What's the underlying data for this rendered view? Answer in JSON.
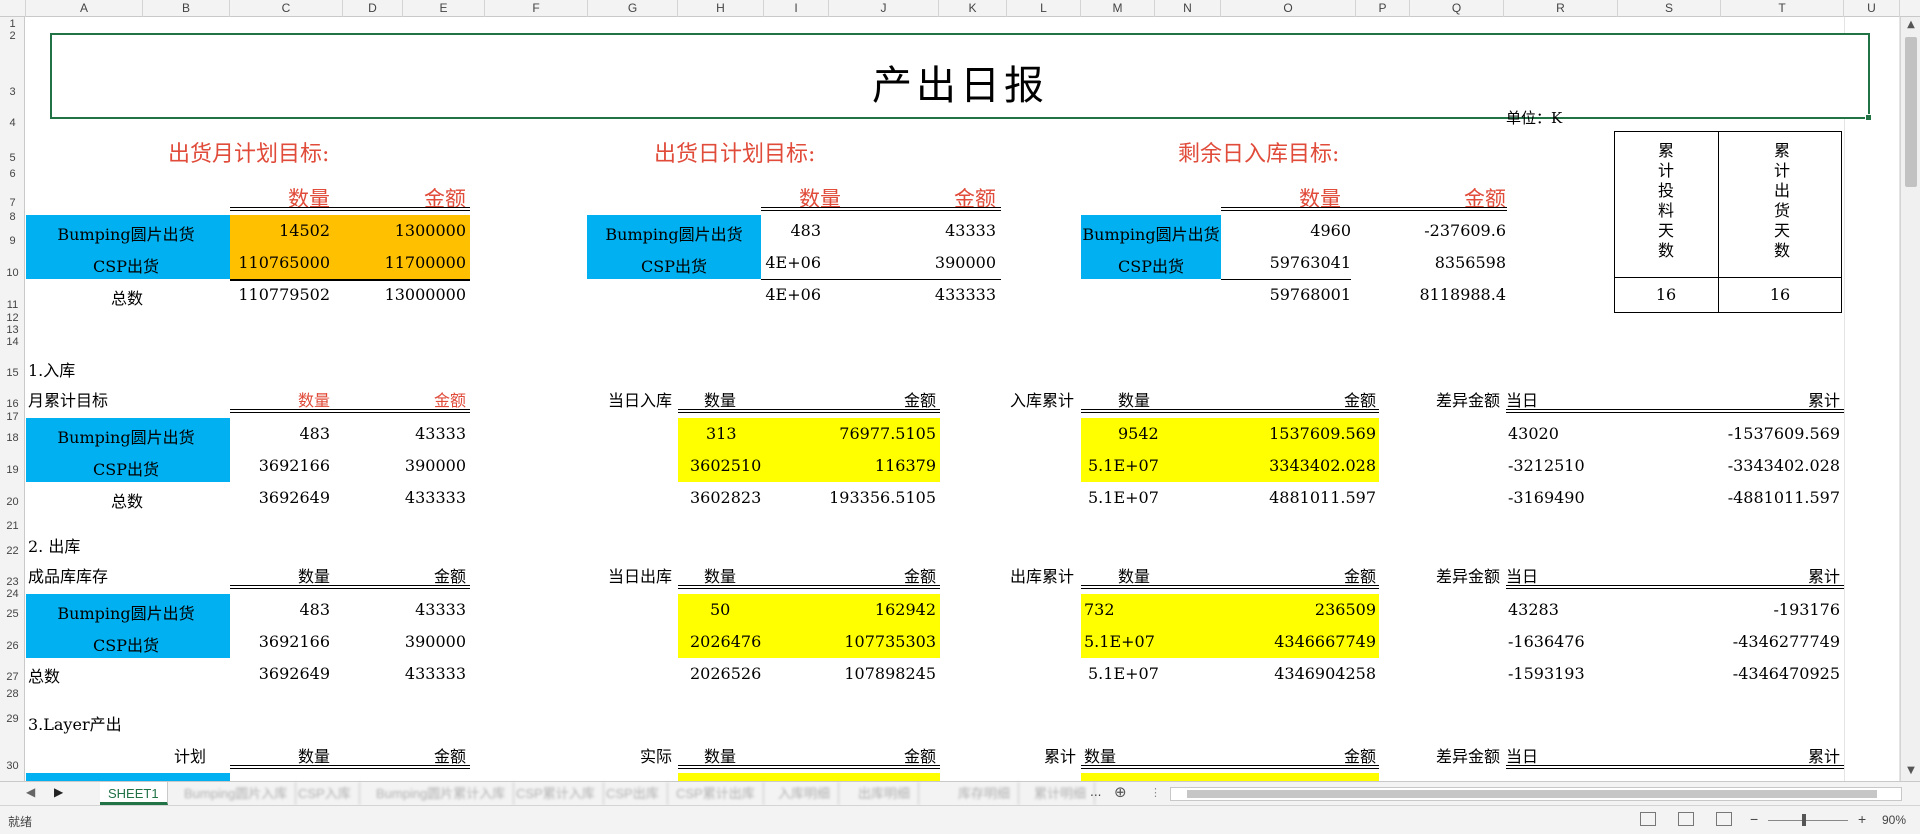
{
  "columns": [
    "A",
    "B",
    "C",
    "D",
    "E",
    "F",
    "G",
    "H",
    "I",
    "J",
    "K",
    "L",
    "M",
    "N",
    "O",
    "P",
    "Q",
    "R",
    "S",
    "T",
    "U"
  ],
  "rows": [
    "1",
    "2",
    "3",
    "4",
    "5",
    "6",
    "7",
    "8",
    "9",
    "10",
    "11",
    "12",
    "13",
    "14",
    "15",
    "16",
    "17",
    "18",
    "19",
    "20",
    "21",
    "22",
    "23",
    "24",
    "25",
    "26",
    "27",
    "28",
    "29",
    "30"
  ],
  "title": "产出日报",
  "unit": "单位：K",
  "header_labels": {
    "qty": "数量",
    "amt": "金额"
  },
  "sections_top": [
    {
      "heading": "出货月计划目标:"
    },
    {
      "heading": "出货日计划目标:"
    },
    {
      "heading": "剩余日入库目标:"
    }
  ],
  "rowlabels": {
    "bumping": "Bumping圆片出货",
    "csp": "CSP出货",
    "total": "总数"
  },
  "monthly": {
    "bumping": [
      "14502",
      "1300000"
    ],
    "csp": [
      "110765000",
      "11700000"
    ],
    "total": [
      "110779502",
      "13000000"
    ]
  },
  "daily": {
    "bumping": [
      "483",
      "43333"
    ],
    "csp": [
      "4E+06",
      "390000"
    ],
    "total": [
      "4E+06",
      "433333"
    ]
  },
  "remaining": {
    "bumping": [
      "4960",
      "-237609.6"
    ],
    "csp": [
      "59763041",
      "8356598"
    ],
    "total": [
      "59768001",
      "8118988.4"
    ]
  },
  "days": {
    "label1": "累计投料天数",
    "label2": "累计出货天数",
    "val1": "16",
    "val2": "16"
  },
  "s1": {
    "title": "1.入库",
    "left": "月累计目标",
    "mid": "当日入库",
    "right": "入库累计",
    "diff": "差异金额",
    "today": "当日",
    "cum": "累计",
    "target": {
      "bumping": [
        "483",
        "43333"
      ],
      "csp": [
        "3692166",
        "390000"
      ],
      "total": [
        "3692649",
        "433333"
      ]
    },
    "day": {
      "bumping": [
        "313",
        "76977.5105"
      ],
      "csp": [
        "3602510",
        "116379"
      ],
      "total": [
        "3602823",
        "193356.5105"
      ]
    },
    "acc": {
      "bumping": [
        "9542",
        "1537609.569"
      ],
      "csp": [
        "5.1E+07",
        "3343402.028"
      ],
      "total": [
        "5.1E+07",
        "4881011.597"
      ]
    },
    "dif": {
      "bumping": [
        "43020",
        "-1537609.569"
      ],
      "csp": [
        "-3212510",
        "-3343402.028"
      ],
      "total": [
        "-3169490",
        "-4881011.597"
      ]
    }
  },
  "s2": {
    "title": "2.  出库",
    "left": "成品库库存",
    "mid": "当日出库",
    "right": "出库累计",
    "diff": "差异金额",
    "today": "当日",
    "cum": "累计",
    "target": {
      "bumping": [
        "483",
        "43333"
      ],
      "csp": [
        "3692166",
        "390000"
      ],
      "total": [
        "3692649",
        "433333"
      ]
    },
    "day": {
      "bumping": [
        "50",
        "162942"
      ],
      "csp": [
        "2026476",
        "107735303"
      ],
      "total": [
        "2026526",
        "107898245"
      ]
    },
    "acc": {
      "bumping": [
        "732",
        "236509"
      ],
      "csp": [
        "5.1E+07",
        "4346667749"
      ],
      "total": [
        "5.1E+07",
        "4346904258"
      ]
    },
    "dif": {
      "bumping": [
        "43283",
        "-193176"
      ],
      "csp": [
        "-1636476",
        "-4346277749"
      ],
      "total": [
        "-1593193",
        "-4346470925"
      ]
    }
  },
  "s3": {
    "title": "3.Layer产出",
    "left": "计划",
    "mid": "实际",
    "right": "累计",
    "diff": "差异金额",
    "today": "当日",
    "cum": "累计"
  },
  "tabs": [
    "SHEET1",
    "Bumping圆片入库",
    "CSP入库",
    "Bumping圆片累计入库",
    "CSP累计入库",
    "CSP出库",
    "CSP累计出库",
    "入库明细",
    "出库明细",
    "库存明细",
    "累计明细"
  ],
  "tab_more": "...",
  "status": {
    "ready": "就绪",
    "zoom": "90%"
  },
  "colors": {
    "cyan": "#00b0f0",
    "orange": "#ffc000",
    "yellow": "#ffff00",
    "red": "#e04b3a",
    "excel_green": "#217346"
  }
}
